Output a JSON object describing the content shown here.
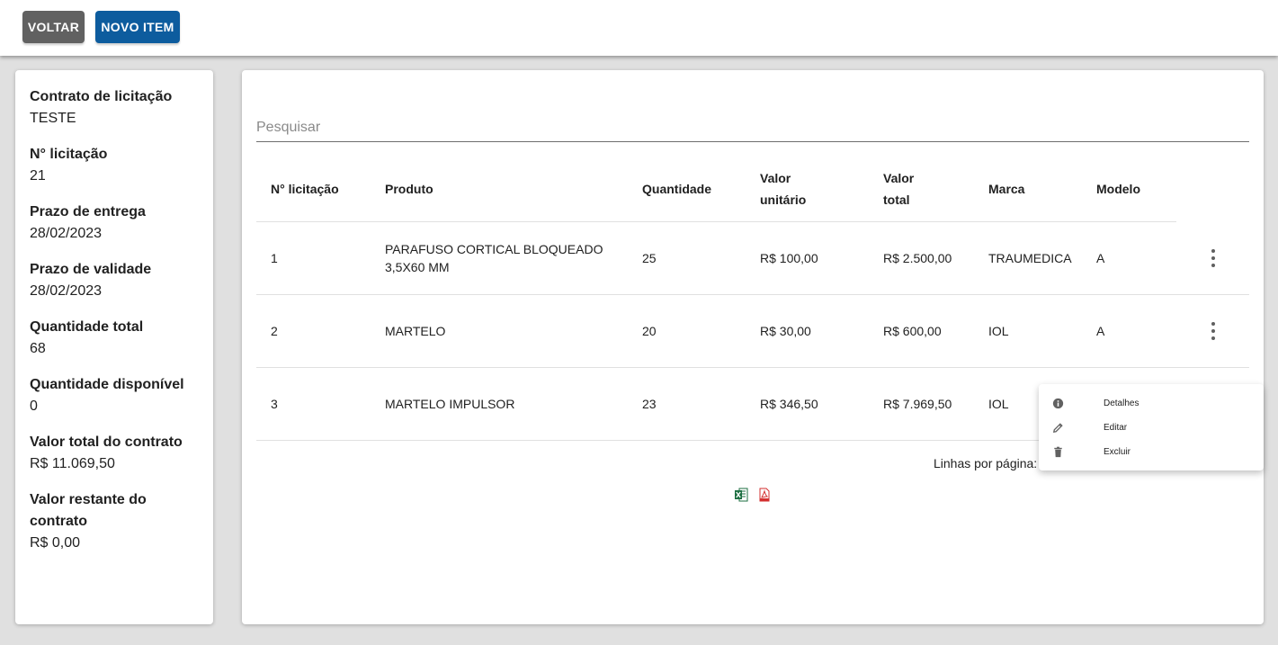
{
  "toolbar": {
    "back_label": "VOLTAR",
    "new_item_label": "NOVO ITEM"
  },
  "summary": [
    {
      "label": "Contrato de licitação",
      "value": "TESTE"
    },
    {
      "label": "N° licitação",
      "value": "21"
    },
    {
      "label": "Prazo de entrega",
      "value": "28/02/2023"
    },
    {
      "label": "Prazo de validade",
      "value": "28/02/2023"
    },
    {
      "label": "Quantidade total",
      "value": "68"
    },
    {
      "label": "Quantidade disponível",
      "value": "0"
    },
    {
      "label": "Valor total do contrato",
      "value": "R$ 11.069,50"
    },
    {
      "label": "Valor restante do contrato",
      "value": "R$ 0,00"
    }
  ],
  "search": {
    "placeholder": "Pesquisar"
  },
  "table": {
    "headers": [
      "N° licitação",
      "Produto",
      "Quantidade",
      "Valor unitário",
      "Valor total",
      "Marca",
      "Modelo"
    ],
    "rows": [
      [
        "1",
        "PARAFUSO CORTICAL BLOQUEADO 3,5X60 MM",
        "25",
        "R$ 100,00",
        "R$ 2.500,00",
        "TRAUMEDICA",
        "A"
      ],
      [
        "2",
        "MARTELO",
        "20",
        "R$ 30,00",
        "R$ 600,00",
        "IOL",
        "A"
      ],
      [
        "3",
        "MARTELO IMPULSOR",
        "23",
        "R$ 346,50",
        "R$ 7.969,50",
        "IOL",
        ""
      ]
    ]
  },
  "pagination": {
    "rows_per_page_label": "Linhas por página:"
  },
  "exports": [
    {
      "icon": "excel-icon",
      "color": "#1d6f42"
    },
    {
      "icon": "pdf-icon",
      "color": "#d32f2f"
    }
  ],
  "context_menu": {
    "items": [
      {
        "label": "Detalhes",
        "icon": "info-icon"
      },
      {
        "label": "Editar",
        "icon": "pencil-icon"
      },
      {
        "label": "Excluir",
        "icon": "trash-icon"
      }
    ]
  },
  "colors": {
    "primary": "#0d5c9e",
    "secondary": "#616161"
  }
}
